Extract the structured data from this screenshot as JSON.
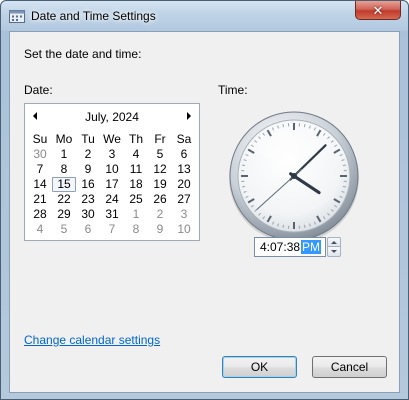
{
  "window": {
    "title": "Date and Time Settings",
    "close_glyph": "✕"
  },
  "main": {
    "heading": "Set the date and time:",
    "date_label": "Date:",
    "time_label": "Time:"
  },
  "calendar": {
    "month_title": "July, 2024",
    "weekdays": [
      "Su",
      "Mo",
      "Tu",
      "We",
      "Th",
      "Fr",
      "Sa"
    ],
    "weeks": [
      [
        {
          "d": "30",
          "dim": true
        },
        {
          "d": "1"
        },
        {
          "d": "2"
        },
        {
          "d": "3"
        },
        {
          "d": "4"
        },
        {
          "d": "5"
        },
        {
          "d": "6"
        }
      ],
      [
        {
          "d": "7"
        },
        {
          "d": "8"
        },
        {
          "d": "9"
        },
        {
          "d": "10"
        },
        {
          "d": "11"
        },
        {
          "d": "12"
        },
        {
          "d": "13"
        }
      ],
      [
        {
          "d": "14"
        },
        {
          "d": "15",
          "today": true
        },
        {
          "d": "16"
        },
        {
          "d": "17"
        },
        {
          "d": "18"
        },
        {
          "d": "19"
        },
        {
          "d": "20"
        }
      ],
      [
        {
          "d": "21"
        },
        {
          "d": "22"
        },
        {
          "d": "23"
        },
        {
          "d": "24"
        },
        {
          "d": "25"
        },
        {
          "d": "26"
        },
        {
          "d": "27"
        }
      ],
      [
        {
          "d": "28"
        },
        {
          "d": "29"
        },
        {
          "d": "30"
        },
        {
          "d": "31"
        },
        {
          "d": "1",
          "dim": true
        },
        {
          "d": "2",
          "dim": true
        },
        {
          "d": "3",
          "dim": true
        }
      ],
      [
        {
          "d": "4",
          "dim": true
        },
        {
          "d": "5",
          "dim": true
        },
        {
          "d": "6",
          "dim": true
        },
        {
          "d": "7",
          "dim": true
        },
        {
          "d": "8",
          "dim": true
        },
        {
          "d": "9",
          "dim": true
        },
        {
          "d": "10",
          "dim": true
        }
      ]
    ]
  },
  "clock": {
    "hour": 4,
    "minute": 7,
    "second": 38
  },
  "time_field": {
    "hm": "4:07:38",
    "ampm": "PM"
  },
  "footer": {
    "link_label": "Change calendar settings",
    "ok_label": "OK",
    "cancel_label": "Cancel"
  },
  "colors": {
    "link": "#0066cc",
    "selection": "#3399ff",
    "close_button": "#c13a2c"
  }
}
